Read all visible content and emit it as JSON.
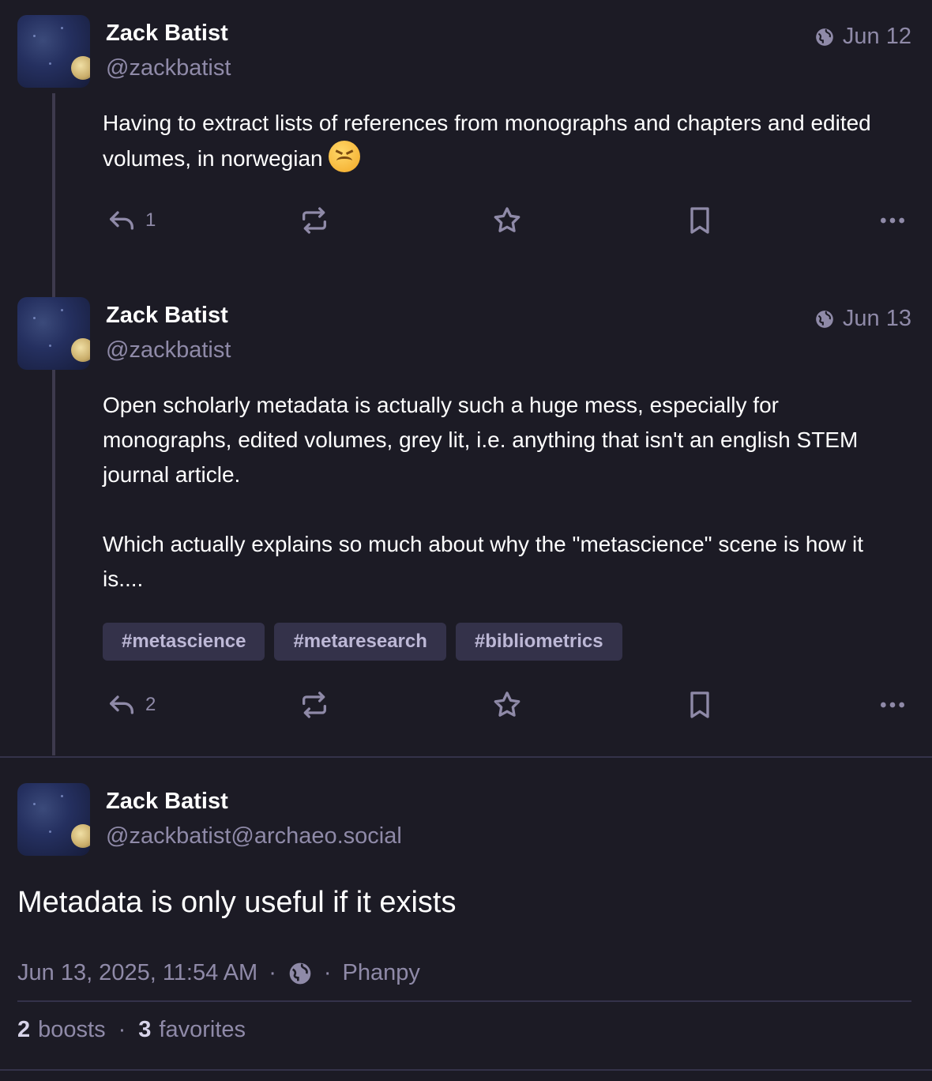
{
  "posts": [
    {
      "name": "Zack Batist",
      "handle": "@zackbatist",
      "date": "Jun 12",
      "text": "Having to extract lists of references from monographs and chapters and edited volumes, in norwegian",
      "reply_count": "1",
      "emoji": "confounded-face"
    },
    {
      "name": "Zack Batist",
      "handle": "@zackbatist",
      "date": "Jun 13",
      "paragraph1": "Open scholarly metadata is actually such a huge mess, especially for monographs, edited volumes, grey lit, i.e. anything that isn't an english STEM journal article.",
      "paragraph2": "Which actually explains so much about why the \"metascience\" scene is how it is....",
      "tags": [
        "#metascience",
        "#metaresearch",
        "#bibliometrics"
      ],
      "reply_count": "2"
    }
  ],
  "main": {
    "name": "Zack Batist",
    "handle": "@zackbatist@archaeo.social",
    "text": "Metadata is only useful if it exists",
    "timestamp": "Jun 13, 2025, 11:54 AM",
    "separator": "·",
    "visibility_icon": "globe-icon",
    "client": "Phanpy",
    "boosts_count": "2",
    "boosts_label": "boosts",
    "favorites_count": "3",
    "favorites_label": "favorites"
  },
  "colors": {
    "background": "#1c1b25",
    "muted": "#8f8aa8",
    "tag_bg": "#34324a"
  }
}
